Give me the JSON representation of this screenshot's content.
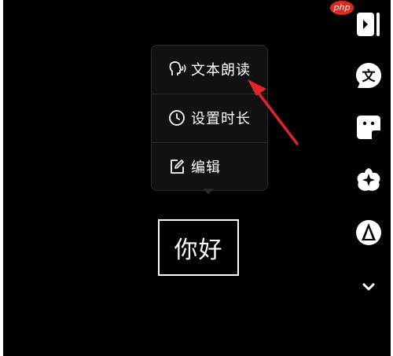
{
  "watermark": "php",
  "menu": {
    "items": [
      {
        "label": "文本朗读",
        "icon": "head-speaking-icon"
      },
      {
        "label": "设置时长",
        "icon": "clock-icon"
      },
      {
        "label": "编辑",
        "icon": "edit-icon"
      }
    ]
  },
  "canvas": {
    "text": "你好"
  },
  "toolbar": {
    "text_glyph": "文"
  },
  "colors": {
    "background": "#000000",
    "menu_bg": "#111111",
    "annotation_arrow": "#e3222b"
  }
}
